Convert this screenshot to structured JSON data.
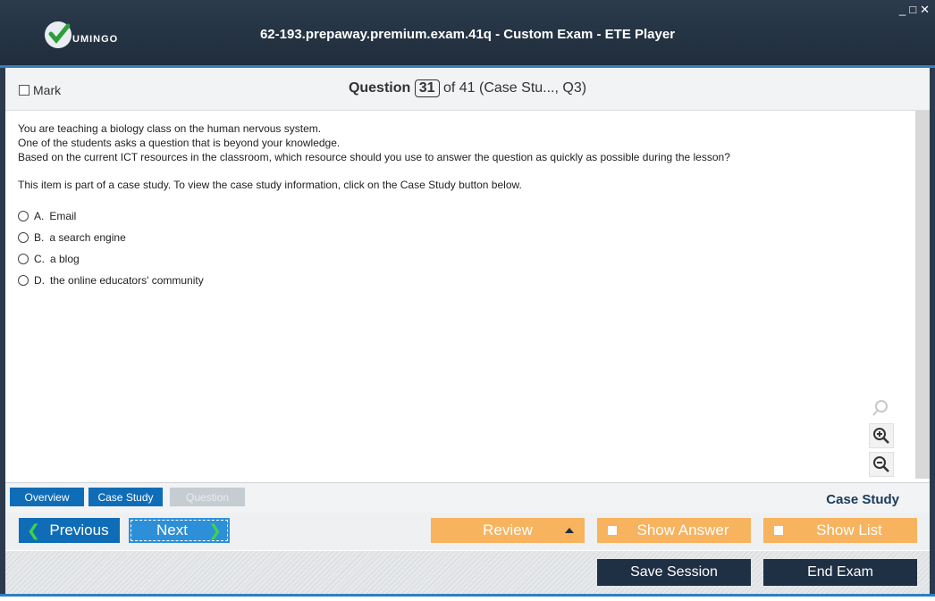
{
  "window": {
    "title": "62-193.prepaway.premium.exam.41q - Custom Exam - ETE Player",
    "logo_text": "UMINGO",
    "controls": [
      "_",
      "□",
      "✕"
    ]
  },
  "header": {
    "mark_label": "Mark",
    "question_label": "Question",
    "question_number": "31",
    "question_suffix": "of 41 (Case Stu..., Q3)"
  },
  "question": {
    "stem": [
      "You are teaching a biology class on the human nervous system.",
      "One of the students asks a question that is beyond your knowledge.",
      "Based on the current ICT resources in the classroom, which resource should you use to answer the question as quickly as possible during the lesson?"
    ],
    "note": "This item is part of a case study. To view the case study information, click on the Case Study button below.",
    "options": [
      {
        "letter": "A.",
        "text": "Email"
      },
      {
        "letter": "B.",
        "text": "a search engine"
      },
      {
        "letter": "C.",
        "text": "a blog"
      },
      {
        "letter": "D.",
        "text": "the online educators' community"
      }
    ]
  },
  "tabs": {
    "overview": "Overview",
    "case_study": "Case Study",
    "question": "Question",
    "section_label": "Case Study"
  },
  "nav": {
    "previous": "Previous",
    "next": "Next",
    "review": "Review",
    "show_answer": "Show Answer",
    "show_list": "Show List"
  },
  "footer": {
    "save_session": "Save Session",
    "end_exam": "End Exam"
  },
  "colors": {
    "titlebar": "#1f2c3b",
    "accent_blue": "#0f6db8",
    "orange": "#f7b35e",
    "dark_button": "#1f2f44"
  }
}
